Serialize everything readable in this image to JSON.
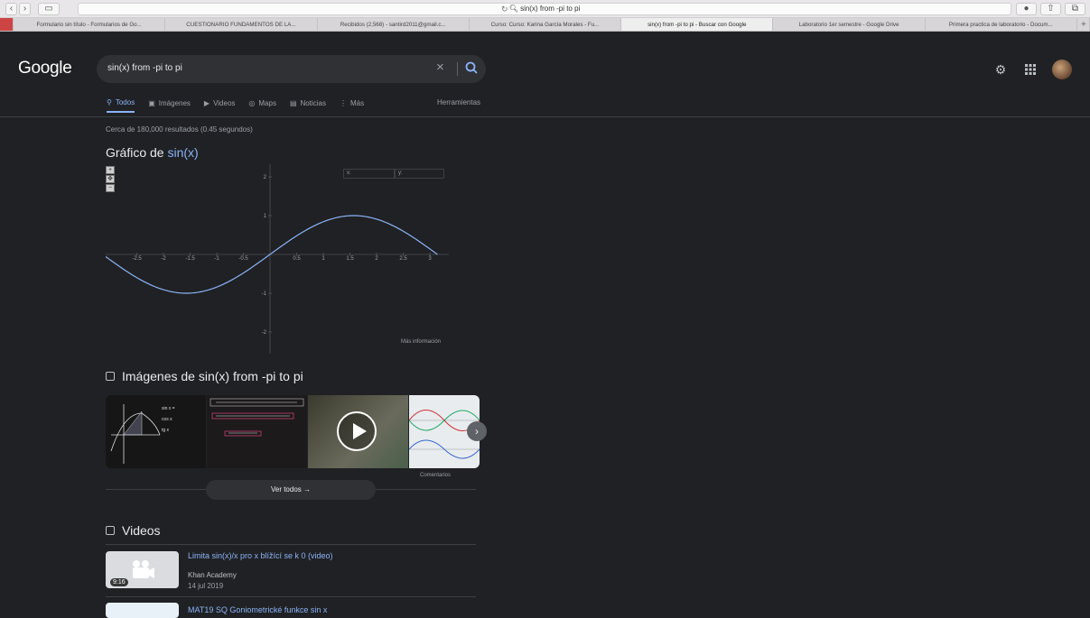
{
  "browser": {
    "url": "sin(x) from -pi to pi",
    "tabs": [
      "Formulario sin título - Formularios de Go...",
      "CUESTIONARIO FUNDAMENTOS DE LA...",
      "Recibidos (2,568) - santird2011@gmail.c...",
      "Curso: Curso: Karina García Morales - Fu...",
      "sin(x) from -pi to pi - Buscar con Google",
      "Laboratorio 1er semestre - Google Drive",
      "Primera practica de laboratorio - Docum..."
    ],
    "active_tab": 4
  },
  "google": {
    "logo": "Google",
    "query": "sin(x) from -pi to pi",
    "nav": [
      {
        "label": "Todos",
        "icon": "search-icon"
      },
      {
        "label": "Imágenes",
        "icon": "image-icon"
      },
      {
        "label": "Videos",
        "icon": "video-icon"
      },
      {
        "label": "Maps",
        "icon": "map-pin-icon"
      },
      {
        "label": "Noticias",
        "icon": "news-icon"
      },
      {
        "label": "Más",
        "icon": "more-icon"
      }
    ],
    "tools": "Herramientas"
  },
  "results": {
    "stats": "Cerca de 180,000 resultados (0.45 segundos)",
    "graph_title_prefix": "Gráfico de ",
    "graph_title_fn": "sin(x)",
    "x_label": "x:",
    "y_label": "y:",
    "more_info": "Más información",
    "images_heading": "Imágenes de sin(x) from -pi to pi",
    "comments": "Comentarios",
    "see_all": "Ver todos",
    "videos_heading": "Videos",
    "videos": [
      {
        "title": "Limita sin(x)/x pro x blížící se k 0 (video)",
        "channel": "Khan Academy",
        "date": "14 jul 2019",
        "duration": "9:16"
      },
      {
        "title": "MAT19 SQ Goniometrické funkce sin x",
        "channel": "",
        "date": "",
        "duration": ""
      }
    ]
  },
  "chart_data": {
    "type": "line",
    "title": "Gráfico de sin(x)",
    "function": "sin(x)",
    "xlim": [
      -3.2,
      3.2
    ],
    "ylim": [
      -2,
      2
    ],
    "x_ticks": [
      -2.5,
      -2,
      -1.5,
      -1,
      -0.5,
      0.5,
      1,
      1.5,
      2,
      2.5,
      3
    ],
    "y_ticks": [
      2,
      1,
      -1,
      -2
    ],
    "series": [
      {
        "x": [
          -3.14,
          -2.5,
          -2.0,
          -1.57,
          -1.0,
          -0.5,
          0,
          0.5,
          1.0,
          1.57,
          2.0,
          2.5,
          3.14
        ],
        "y": [
          0,
          -0.6,
          -0.91,
          -1,
          -0.84,
          -0.48,
          0,
          0.48,
          0.84,
          1,
          0.91,
          0.6,
          0
        ]
      }
    ],
    "colors": {
      "line": "#8ab4f8",
      "axis": "#9aa0a6"
    }
  }
}
